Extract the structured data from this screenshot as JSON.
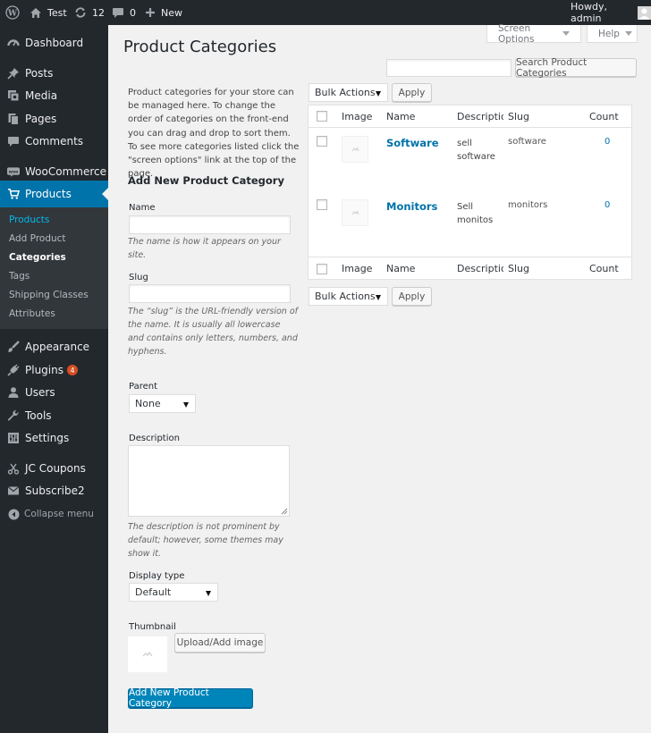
{
  "adminbar": {
    "site_name": "Test",
    "updates_count": "12",
    "comments_count": "0",
    "new_label": "New",
    "greeting": "Howdy, admin"
  },
  "sidebar": {
    "items": {
      "dashboard": "Dashboard",
      "posts": "Posts",
      "media": "Media",
      "pages": "Pages",
      "comments": "Comments",
      "woocommerce": "WooCommerce",
      "products": "Products",
      "appearance": "Appearance",
      "plugins": "Plugins",
      "plugins_badge": "4",
      "users": "Users",
      "tools": "Tools",
      "settings": "Settings",
      "jc_coupons": "JC Coupons",
      "subscribe2": "Subscribe2",
      "collapse": "Collapse menu"
    },
    "submenu": {
      "products": "Products",
      "add_product": "Add Product",
      "categories": "Categories",
      "tags": "Tags",
      "shipping_classes": "Shipping Classes",
      "attributes": "Attributes"
    }
  },
  "header": {
    "screen_options": "Screen Options",
    "help": "Help",
    "page_title": "Product Categories"
  },
  "search": {
    "value": "",
    "button": "Search Product Categories"
  },
  "intro_text": "Product categories for your store can be managed here. To change the order of categories on the front-end you can drag and drop to sort them. To see more categories listed click the \"screen options\" link at the top of the page.",
  "form": {
    "heading": "Add New Product Category",
    "name_label": "Name",
    "name_value": "",
    "name_help": "The name is how it appears on your site.",
    "slug_label": "Slug",
    "slug_value": "",
    "slug_help": "The “slug” is the URL-friendly version of the name. It is usually all lowercase and contains only letters, numbers, and hyphens.",
    "parent_label": "Parent",
    "parent_value": "None",
    "description_label": "Description",
    "description_value": "",
    "description_help": "The description is not prominent by default; however, some themes may show it.",
    "display_type_label": "Display type",
    "display_type_value": "Default",
    "thumbnail_label": "Thumbnail",
    "upload_button": "Upload/Add image",
    "submit_button": "Add New Product Category"
  },
  "table": {
    "bulk_actions_top": "Bulk Actions",
    "apply_top": "Apply",
    "bulk_actions_bottom": "Bulk Actions",
    "apply_bottom": "Apply",
    "columns": {
      "image": "Image",
      "name": "Name",
      "description": "Descriptio",
      "slug": "Slug",
      "count": "Count"
    },
    "rows": [
      {
        "name": "Software",
        "description": "sell software",
        "slug": "software",
        "count": "0"
      },
      {
        "name": "Monitors",
        "description": "Sell monitos",
        "slug": "monitors",
        "count": "0"
      }
    ]
  },
  "colors": {
    "admin_bg": "#23282d",
    "active_menu": "#0073aa",
    "link": "#0073aa",
    "primary_button": "#0085ba",
    "badge": "#d54e21",
    "page_bg": "#f1f1f1"
  }
}
